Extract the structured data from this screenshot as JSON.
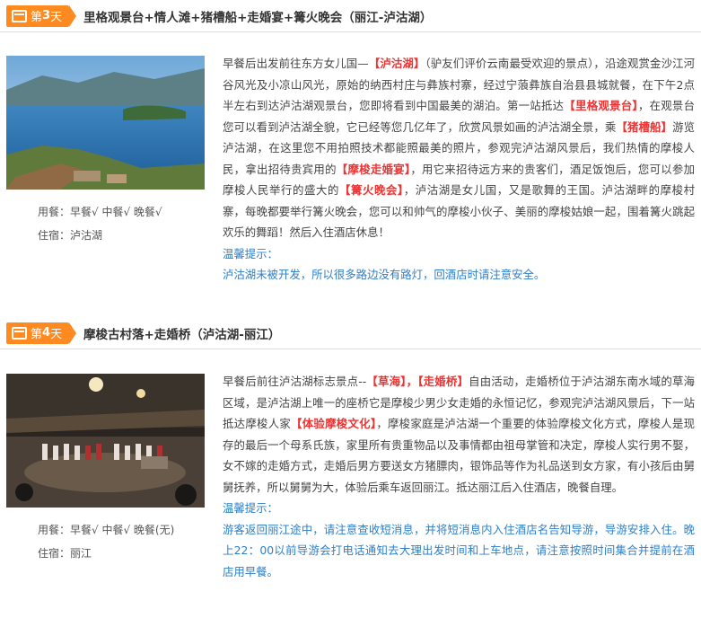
{
  "day3": {
    "badge_prefix": "第",
    "badge_num": "3",
    "badge_suffix": "天",
    "title": "里格观景台+情人滩+猪槽船+走婚宴+篝火晚会（丽江-泸沽湖）",
    "meals": "用餐：早餐√  中餐√  晚餐√",
    "stay": "住宿：泸沽湖",
    "t1": "早餐后出发前往东方女儿国—",
    "h1": "【泸沽湖】",
    "t2": "（驴友们评价云南最受欢迎的景点），沿途观赏金沙江河谷风光及小凉山风光，原始的纳西村庄与彝族村寨，经过宁蒗彝族自治县县城就餐，在下午2点半左右到达泸沽湖观景台，您即将看到中国最美的湖泊。第一站抵达",
    "h2": "【里格观景台】",
    "t3": "，在观景台您可以看到泸沽湖全貌，它已经等您几亿年了，欣赏风景如画的泸沽湖全景，乘",
    "h3": "【猪槽船】",
    "t4": "游览泸沽湖，在这里您不用拍照技术都能照最美的照片，参观完泸沽湖风景后，我们热情的摩梭人民，拿出招待贵宾用的",
    "h4": "【摩梭走婚宴】",
    "t5": "，用它来招待远方来的贵客们，酒足饭饱后，您可以参加摩梭人民举行的盛大的",
    "h5": "【篝火晚会】",
    "t6": "，泸沽湖是女儿国，又是歌舞的王国。泸沽湖畔的摩梭村寨，每晚都要举行篝火晚会，您可以和帅气的摩梭小伙子、美丽的摩梭姑娘一起，围着篝火跳起欢乐的舞蹈！然后入住酒店休息！",
    "tip_title": "温馨提示：",
    "tip": "泸沽湖未被开发，所以很多路边没有路灯，回酒店时请注意安全。"
  },
  "day4": {
    "badge_prefix": "第",
    "badge_num": "4",
    "badge_suffix": "天",
    "title": "摩梭古村落+走婚桥（泸沽湖-丽江）",
    "meals": "用餐：早餐√  中餐√  晚餐(无)",
    "stay": "住宿：丽江",
    "t1": "早餐后前往泸沽湖标志景点--",
    "h1": "【草海】，",
    "h2": "【走婚桥】",
    "t2": "自由活动，走婚桥位于泸沽湖东南水域的草海区域，是泸沽湖上唯一的座桥它是摩梭少男少女走婚的永恒记忆，参观完泸沽湖风景后，下一站抵达摩梭人家",
    "h3": "【体验摩梭文化】",
    "t3": "，摩梭家庭是泸沽湖一个重要的体验摩梭文化方式，摩梭人是现存的最后一个母系氏族，家里所有贵重物品以及事情都由祖母掌管和决定，摩梭人实行男不娶，女不嫁的走婚方式，走婚后男方要送女方猪膘肉，银饰品等作为礼品送到女方家，有小孩后由舅舅抚养，所以舅舅为大，体验后乘车返回丽江。抵达丽江后入住酒店，晚餐自理。",
    "tip_title": "温馨提示：",
    "tip": "游客返回丽江途中，请注意查收短消息，并将短消息内入住酒店名告知导游，导游安排入住。晚上22：00以前导游会打电话通知去大理出发时间和上车地点，请注意按照时间集合并提前在酒店用早餐。"
  },
  "colors": {
    "accent": "#ff8a1f",
    "highlight": "#e33333",
    "tip": "#2d7fc7"
  },
  "icons": {
    "badge": "calendar-icon"
  }
}
